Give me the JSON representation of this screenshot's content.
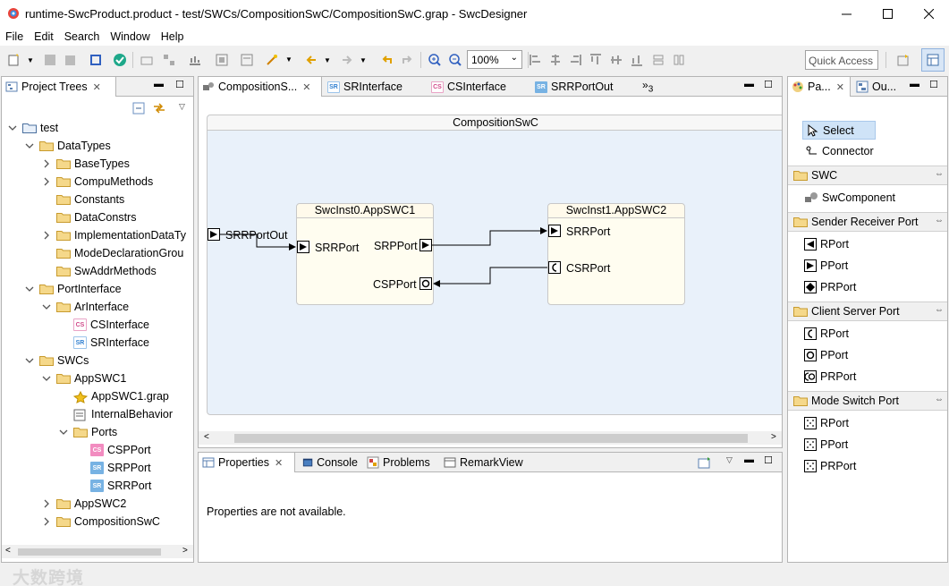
{
  "window": {
    "title": "runtime-SwcProduct.product - test/SWCs/CompositionSwC/CompositionSwC.grap - SwcDesigner",
    "minimize": "—",
    "maximize": "☐",
    "close": "✕"
  },
  "menu": [
    "File",
    "Edit",
    "Search",
    "Window",
    "Help"
  ],
  "toolbar": {
    "zoom": "100%",
    "quick_access": "Quick Access"
  },
  "left_panel": {
    "tab": "Project Trees",
    "tree": [
      {
        "label": "test",
        "depth": 0,
        "expanded": true,
        "icon": "project-folder"
      },
      {
        "label": "DataTypes",
        "depth": 1,
        "expanded": true,
        "icon": "folder"
      },
      {
        "label": "BaseTypes",
        "depth": 2,
        "expanded": false,
        "icon": "folder"
      },
      {
        "label": "CompuMethods",
        "depth": 2,
        "expanded": false,
        "icon": "folder"
      },
      {
        "label": "Constants",
        "depth": 2,
        "expanded": null,
        "icon": "folder"
      },
      {
        "label": "DataConstrs",
        "depth": 2,
        "expanded": null,
        "icon": "folder"
      },
      {
        "label": "ImplementationDataTy",
        "depth": 2,
        "expanded": false,
        "icon": "folder"
      },
      {
        "label": "ModeDeclarationGrou",
        "depth": 2,
        "expanded": null,
        "icon": "folder"
      },
      {
        "label": "SwAddrMethods",
        "depth": 2,
        "expanded": null,
        "icon": "folder"
      },
      {
        "label": "PortInterface",
        "depth": 1,
        "expanded": true,
        "icon": "folder"
      },
      {
        "label": "ArInterface",
        "depth": 2,
        "expanded": true,
        "icon": "folder"
      },
      {
        "label": "CSInterface",
        "depth": 3,
        "expanded": null,
        "icon": "cs"
      },
      {
        "label": "SRInterface",
        "depth": 3,
        "expanded": null,
        "icon": "sr"
      },
      {
        "label": "SWCs",
        "depth": 1,
        "expanded": true,
        "icon": "folder"
      },
      {
        "label": "AppSWC1",
        "depth": 2,
        "expanded": true,
        "icon": "folder"
      },
      {
        "label": "AppSWC1.grap",
        "depth": 3,
        "expanded": null,
        "icon": "grap"
      },
      {
        "label": "InternalBehavior",
        "depth": 3,
        "expanded": null,
        "icon": "behavior"
      },
      {
        "label": "Ports",
        "depth": 3,
        "expanded": true,
        "icon": "folder"
      },
      {
        "label": "CSPPort",
        "depth": 4,
        "expanded": null,
        "icon": "cs-fill"
      },
      {
        "label": "SRPPort",
        "depth": 4,
        "expanded": null,
        "icon": "sr-fill"
      },
      {
        "label": "SRRPort",
        "depth": 4,
        "expanded": null,
        "icon": "sr-fill"
      },
      {
        "label": "AppSWC2",
        "depth": 2,
        "expanded": false,
        "icon": "folder"
      },
      {
        "label": "CompositionSwC",
        "depth": 2,
        "expanded": false,
        "icon": "folder"
      }
    ]
  },
  "editor": {
    "tabs": [
      {
        "label": "CompositionS...",
        "icon": "composition",
        "active": true
      },
      {
        "label": "SRInterface",
        "icon": "sr",
        "active": false
      },
      {
        "label": "CSInterface",
        "icon": "cs",
        "active": false
      },
      {
        "label": "SRRPortOut",
        "icon": "sr-fill",
        "active": false
      }
    ],
    "overflow_count": "3",
    "diagram": {
      "composition_title": "CompositionSwC",
      "external_port": "SRRPortOut",
      "inst0": {
        "title": "SwcInst0.AppSWC1",
        "ports": [
          "SRRPort",
          "SRPPort",
          "CSPPort"
        ]
      },
      "inst1": {
        "title": "SwcInst1.AppSWC2",
        "ports": [
          "SRRPort",
          "CSRPort"
        ]
      }
    }
  },
  "bottom_panel": {
    "tabs": [
      "Properties",
      "Console",
      "Problems",
      "RemarkView"
    ],
    "message": "Properties are not available."
  },
  "right_panel": {
    "tabs": [
      "Pa...",
      "Ou..."
    ],
    "tools": [
      "Select",
      "Connector"
    ],
    "sections": [
      {
        "title": "SWC",
        "items": [
          "SwComponent"
        ]
      },
      {
        "title": "Sender Receiver Port",
        "items": [
          "RPort",
          "PPort",
          "PRPort"
        ]
      },
      {
        "title": "Client Server Port",
        "items": [
          "RPort",
          "PPort",
          "PRPort"
        ]
      },
      {
        "title": "Mode Switch Port",
        "items": [
          "RPort",
          "PPort",
          "PRPort"
        ]
      }
    ]
  },
  "watermark": "大数跨境"
}
